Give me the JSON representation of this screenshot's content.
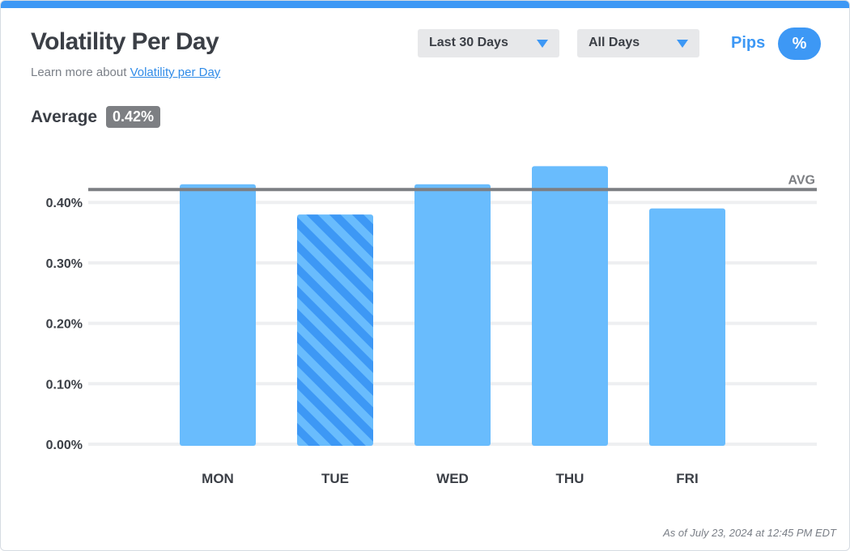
{
  "header": {
    "title": "Volatility Per Day",
    "learn_prefix": "Learn more about ",
    "learn_link": "Volatility per Day"
  },
  "filters": {
    "period": "Last 30 Days",
    "days": "All Days"
  },
  "units": {
    "pips_label": "Pips",
    "percent_label": "%",
    "selected": "%"
  },
  "average": {
    "label": "Average",
    "value": "0.42%"
  },
  "chart_data": {
    "type": "bar",
    "categories": [
      "MON",
      "TUE",
      "WED",
      "THU",
      "FRI"
    ],
    "values": [
      0.43,
      0.38,
      0.43,
      0.46,
      0.39
    ],
    "highlighted_category": "TUE",
    "average_line": {
      "value": 0.42,
      "label": "AVG"
    },
    "yticks": [
      "0.00%",
      "0.10%",
      "0.20%",
      "0.30%",
      "0.40%"
    ],
    "ytick_values": [
      0,
      0.1,
      0.2,
      0.3,
      0.4
    ],
    "ylim": [
      0,
      0.46
    ],
    "grid": true,
    "colors": {
      "bar": "#69bcfd",
      "highlight_stripe": "#3d98f5",
      "avg_line": "#7d7f83",
      "grid": "#eeeff1"
    }
  },
  "footer": {
    "timestamp": "As of July 23, 2024 at 12:45 PM EDT"
  }
}
